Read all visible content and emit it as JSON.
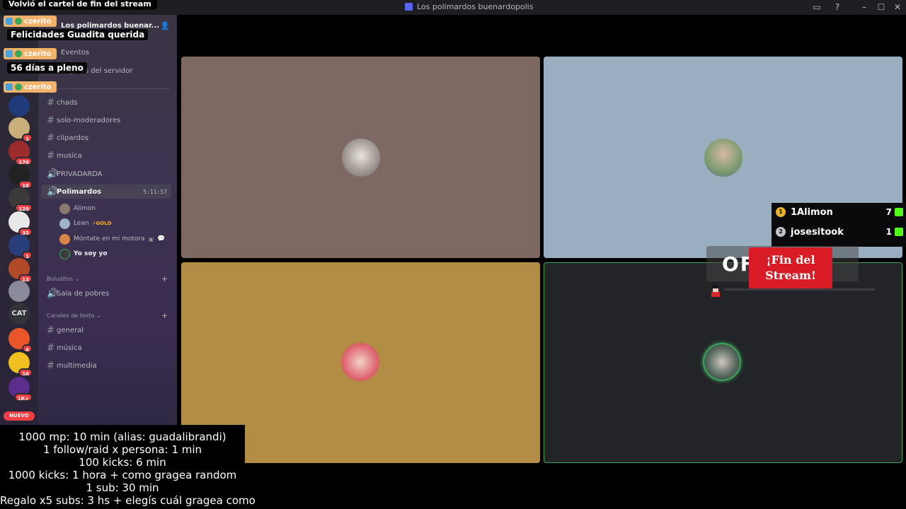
{
  "window": {
    "title": "Los polimardos buenardopolis"
  },
  "overlay": {
    "top_text": "Volvió el cartel de fin del stream",
    "chat": [
      {
        "user": "czerito",
        "message": "Felicidades Guadita querida"
      },
      {
        "user": "czerito",
        "message": "56 días a pleno"
      },
      {
        "user": "czerito",
        "message": ""
      }
    ],
    "leaderboard": [
      {
        "rank": "1",
        "name": "1Alimon",
        "value": "7"
      },
      {
        "rank": "2",
        "name": "josesitook",
        "value": "1"
      }
    ],
    "end_banner": {
      "bg_text": "OFF   DOS",
      "red_line1": "¡Fin del",
      "red_line2": "Stream!"
    },
    "goals": [
      "1000 mp: 10 min (alias: guadalibrandi)",
      "1 follow/raid x persona: 1 min",
      "100 kicks: 6 min",
      "1000 kicks: 1 hora + como gragea random",
      "1 sub: 30 min",
      "Regalo x5 subs: 3 hs + elegís cuál gragea como"
    ]
  },
  "servers": [
    {
      "badge": ""
    },
    {
      "badge": "1"
    },
    {
      "badge": "176"
    },
    {
      "badge": "16"
    },
    {
      "badge": "128"
    },
    {
      "badge": "35"
    },
    {
      "badge": "1"
    },
    {
      "badge": "13"
    },
    {
      "badge": ""
    },
    {
      "label": "CAT",
      "badge": ""
    },
    {
      "badge": "4"
    },
    {
      "badge": "16"
    },
    {
      "badge": "1K+"
    }
  ],
  "server_new_label": "NUEVO",
  "sidebar": {
    "server_name": "Los polimardos buenar...",
    "events": "Eventos",
    "boosts": "Mejoras del servidor",
    "channels": [
      {
        "name": "chads",
        "type": "text"
      },
      {
        "name": "solo-moderadores",
        "type": "text"
      },
      {
        "name": "clipardos",
        "type": "text"
      },
      {
        "name": "musica",
        "type": "text"
      },
      {
        "name": "PRIVADARDA",
        "type": "voice"
      },
      {
        "name": "Polimardos",
        "type": "voice",
        "timer": "5:11:57"
      }
    ],
    "voice_users": [
      {
        "name": "Alimon",
        "tag": ""
      },
      {
        "name": "Lean",
        "tag": "GOLD"
      },
      {
        "name": "Móntate en mi motora",
        "tag": ""
      },
      {
        "name": "Yo soy yo",
        "tag": ""
      }
    ],
    "category1": {
      "name": "Boluditos",
      "channels": [
        "Sala de pobres"
      ]
    },
    "category2": {
      "name": "Canales de texto",
      "channels": [
        "general",
        "música",
        "multimedia"
      ]
    }
  }
}
